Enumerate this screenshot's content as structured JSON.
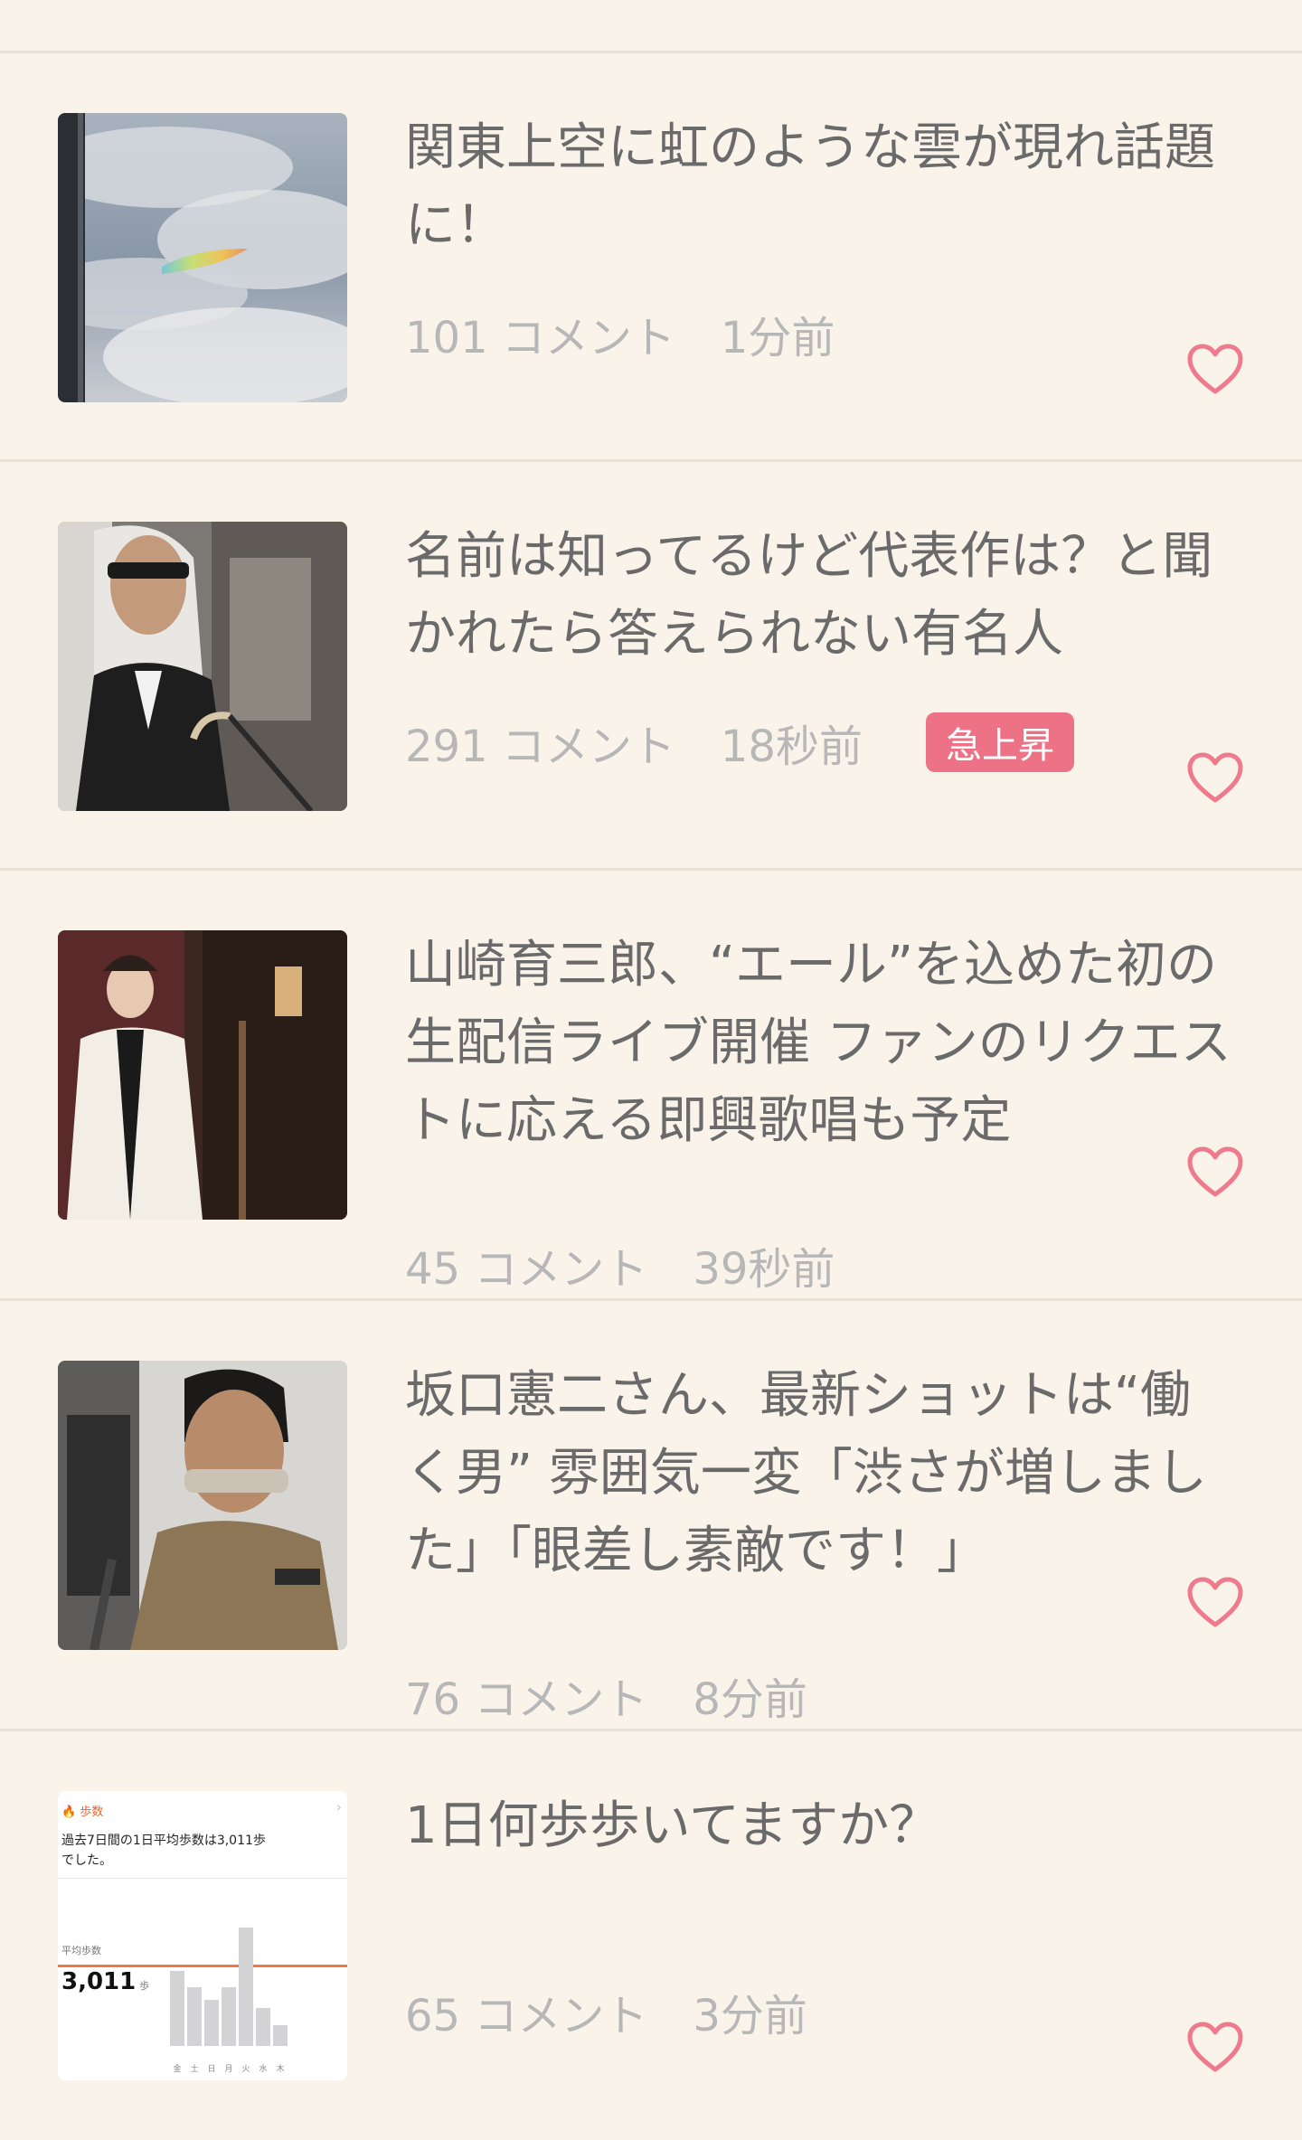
{
  "articles": [
    {
      "title": "関東上空に虹のような雲が現れ話題に！",
      "comments": "101 コメント",
      "time": "1分前",
      "badge": ""
    },
    {
      "title": "名前は知ってるけど代表作は？と聞かれたら答えられない有名人",
      "comments": "291 コメント",
      "time": "18秒前",
      "badge": "急上昇"
    },
    {
      "title": "山崎育三郎、“エール”を込めた初の生配信ライブ開催 ファンのリクエストに応える即興歌唱も予定",
      "comments": "45 コメント",
      "time": "39秒前",
      "badge": ""
    },
    {
      "title": "坂口憲二さん、最新ショットは“働く男” 雰囲気一変「渋さが増しました」「眼差し素敵です！」",
      "comments": "76 コメント",
      "time": "8分前",
      "badge": ""
    },
    {
      "title": "1日何歩歩いてますか？",
      "comments": "65 コメント",
      "time": "3分前",
      "badge": ""
    }
  ],
  "health_card": {
    "app_label": "歩数",
    "summary": "過去7日間の1日平均歩数は3,011歩でした。",
    "avg_label": "平均歩数",
    "avg_value": "3,011",
    "unit": "歩",
    "days": [
      "金",
      "土",
      "日",
      "月",
      "火",
      "水",
      "木"
    ],
    "bar_levels": [
      0.55,
      0.43,
      0.34,
      0.43,
      0.87,
      0.28,
      0.15
    ]
  },
  "icons": {
    "like": "heart-outline-icon"
  },
  "colors": {
    "background": "#faf3ea",
    "heart": "#ee7a8c",
    "badge": "#ee7286"
  }
}
